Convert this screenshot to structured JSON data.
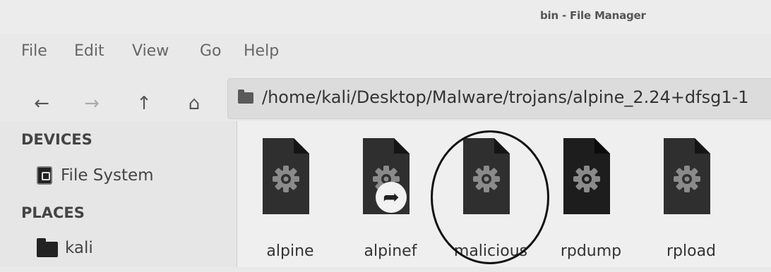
{
  "window": {
    "title": "bin - File Manager"
  },
  "menu": [
    "File",
    "Edit",
    "View",
    "Go",
    "Help"
  ],
  "nav": {
    "back_icon": "arrow-left-icon",
    "forward_icon": "arrow-right-icon",
    "up_icon": "arrow-up-icon",
    "home_icon": "home-icon",
    "back": "←",
    "forward": "→",
    "up": "↑",
    "home": "⌂"
  },
  "location": {
    "path": "/home/kali/Desktop/Malware/trojans/alpine_2.24+dfsg1-1"
  },
  "sidebar": {
    "devices_header": "DEVICES",
    "devices": [
      {
        "label": "File System",
        "icon": "drive-icon"
      }
    ],
    "places_header": "PLACES",
    "places": [
      {
        "label": "kali",
        "icon": "folder-icon"
      }
    ]
  },
  "files": [
    {
      "name": "alpine",
      "icon": "executable-icon",
      "is_link": false
    },
    {
      "name": "alpinef",
      "icon": "executable-icon",
      "is_link": true,
      "badge": "➦"
    },
    {
      "name": "malicious",
      "icon": "executable-icon",
      "is_link": false,
      "annotated": true
    },
    {
      "name": "rpdump",
      "icon": "executable-icon",
      "is_link": false
    },
    {
      "name": "rpload",
      "icon": "executable-icon",
      "is_link": false
    }
  ],
  "colors": {
    "file_icon": "#2f2f2f",
    "file_icon_dark": "#1d1d1d",
    "gear": "#8a8a8a"
  }
}
